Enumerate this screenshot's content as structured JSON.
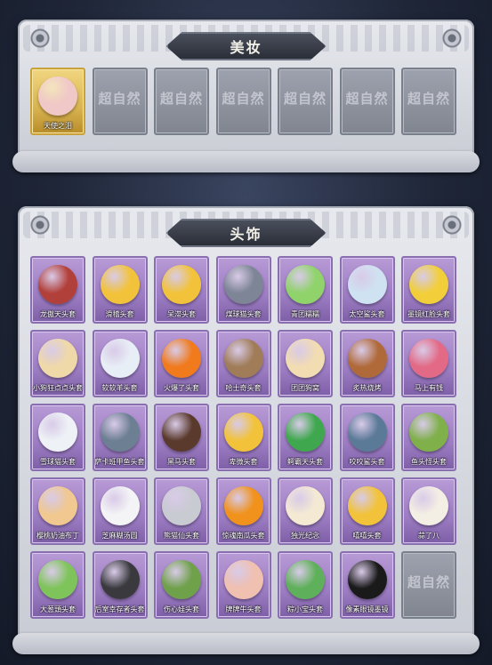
{
  "makeup": {
    "title": "美妆",
    "items": [
      {
        "label": "天使之泪",
        "state": "owned",
        "icon": "angel-wings-face-icon",
        "color": "#f0c8c8"
      },
      {
        "label": "",
        "state": "empty",
        "logo": "超自然"
      },
      {
        "label": "",
        "state": "empty",
        "logo": "超自然"
      },
      {
        "label": "",
        "state": "empty",
        "logo": "超自然"
      },
      {
        "label": "",
        "state": "empty",
        "logo": "超自然"
      },
      {
        "label": "",
        "state": "empty",
        "logo": "超自然"
      },
      {
        "label": "",
        "state": "empty",
        "logo": "超自然"
      }
    ]
  },
  "headwear": {
    "title": "头饰",
    "items": [
      {
        "label": "龙傲天头套",
        "icon": "red-dragon-head-icon",
        "color": "#b2403a"
      },
      {
        "label": "滑稽头套",
        "icon": "smirk-face-icon",
        "color": "#f2c33a"
      },
      {
        "label": "呆滞头套",
        "icon": "dazed-face-icon",
        "color": "#f2c33a"
      },
      {
        "label": "煤球猫头套",
        "icon": "gray-cat-head-icon",
        "color": "#7d8596"
      },
      {
        "label": "青团糯糯",
        "icon": "green-dumpling-icon",
        "color": "#8fd36a"
      },
      {
        "label": "太空鲨头套",
        "icon": "shark-astronaut-icon",
        "color": "#cfe2f2"
      },
      {
        "label": "墨镜红脸头套",
        "icon": "sunglasses-pikachu-icon",
        "color": "#f2cf3a"
      },
      {
        "label": "小狗狂点点头套",
        "icon": "yellow-dog-head-icon",
        "color": "#f0d9a8"
      },
      {
        "label": "软软羊头套",
        "icon": "fluffy-sheep-icon",
        "color": "#e8eef6"
      },
      {
        "label": "火爆了头套",
        "icon": "fire-face-icon",
        "color": "#f07a1c"
      },
      {
        "label": "哈士奇头套",
        "icon": "husky-sunglasses-icon",
        "color": "#a07c58"
      },
      {
        "label": "团团狗窝",
        "icon": "hamster-face-icon",
        "color": "#f2dcb2"
      },
      {
        "label": "炙热烧烤",
        "icon": "grilled-meat-icon",
        "color": "#b06a3a"
      },
      {
        "label": "马上有钱",
        "icon": "pink-horse-icon",
        "color": "#e36a86"
      },
      {
        "label": "雪球猫头套",
        "icon": "snowman-reindeer-icon",
        "color": "#eef2f6"
      },
      {
        "label": "萨卡班甲鱼头套",
        "icon": "fish-head-icon",
        "color": "#6d7f93"
      },
      {
        "label": "黑马头套",
        "icon": "black-horse-icon",
        "color": "#5a3a2c"
      },
      {
        "label": "卑微头套",
        "icon": "sad-smile-face-icon",
        "color": "#f2c33a"
      },
      {
        "label": "鳄霸天头套",
        "icon": "crocodile-head-icon",
        "color": "#3fa84e"
      },
      {
        "label": "咬咬鲨头套",
        "icon": "shark-bite-icon",
        "color": "#5a7a98"
      },
      {
        "label": "鱼头怪头套",
        "icon": "fishman-head-icon",
        "color": "#7fb04a"
      },
      {
        "label": "樱桃奶油布丁",
        "icon": "pudding-face-icon",
        "color": "#f0c890"
      },
      {
        "label": "芝麻糊汤圆",
        "icon": "rice-ball-icon",
        "color": "#f4f4f6"
      },
      {
        "label": "熊猫仙头套",
        "icon": "panda-sunglasses-icon",
        "color": "#c9cbd2"
      },
      {
        "label": "惊魂南瓜头套",
        "icon": "pumpkin-head-icon",
        "color": "#f0921c"
      },
      {
        "label": "独光纪念",
        "icon": "candle-face-icon",
        "color": "#f4ead4"
      },
      {
        "label": "嘻嘻头套",
        "icon": "grin-face-icon",
        "color": "#f2c33a"
      },
      {
        "label": "蒜了八",
        "icon": "garlic-face-icon",
        "color": "#f4efe4"
      },
      {
        "label": "大葱頭头套",
        "icon": "green-onion-icon",
        "color": "#7fc45a"
      },
      {
        "label": "后室幸存者头套",
        "icon": "gas-mask-icon",
        "color": "#3a3a3e"
      },
      {
        "label": "伤心娃头套",
        "icon": "sad-frog-icon",
        "color": "#6fa04a"
      },
      {
        "label": "牌牌牛头套",
        "icon": "cow-head-icon",
        "color": "#f0c0b0"
      },
      {
        "label": "粽小宝头套",
        "icon": "zongzi-icon",
        "color": "#5fb05a"
      },
      {
        "label": "像素眼镜墨镜",
        "icon": "pixel-sunglasses-icon",
        "color": "#1a1a1a"
      },
      {
        "label": "",
        "state": "empty",
        "logo": "超自然"
      }
    ]
  }
}
